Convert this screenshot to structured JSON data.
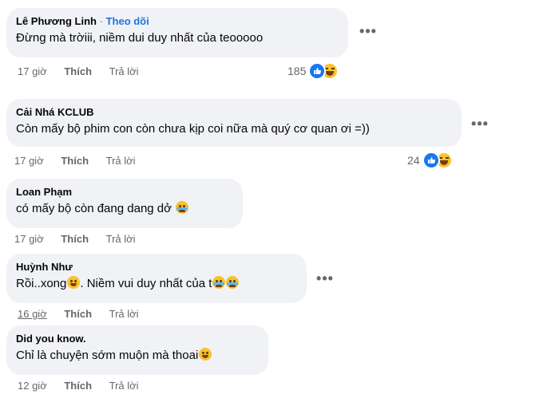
{
  "comments": [
    {
      "author": "Lê Phương Linh",
      "follow_separator": "·",
      "follow_label": "Theo dõi",
      "text": "Đừng mà trờiii, niềm dui duy nhất của teooooo",
      "time": "17 giờ",
      "like_label": "Thích",
      "reply_label": "Trả lời",
      "reaction_count": "185",
      "reactions": [
        "like-icon",
        "haha-icon"
      ]
    },
    {
      "author": "Cải Nhá KCLUB",
      "text": "Còn mấy bộ phim con còn chưa kịp coi nữa mà quý cơ quan ơi =))",
      "time": "17 giờ",
      "like_label": "Thích",
      "reply_label": "Trả lời",
      "reaction_count": "24",
      "reactions": [
        "like-icon",
        "haha-icon"
      ]
    },
    {
      "author": "Loan Phạm",
      "text": "có mấy bộ còn đang dang dở",
      "emoji": [
        "crying-face-icon"
      ],
      "time": "17 giờ",
      "like_label": "Thích",
      "reply_label": "Trả lời"
    },
    {
      "author": "Huỳnh Như",
      "text_parts": [
        "Rồi..xong",
        ". Niềm vui duy nhất của t"
      ],
      "emoji": [
        "sleepy-face-icon",
        "crying-face-icon",
        "crying-face-icon"
      ],
      "time": "16 giờ",
      "like_label": "Thích",
      "reply_label": "Trả lời"
    },
    {
      "author": "Did you know.",
      "text": "Chỉ là chuyện sớm muộn mà thoai",
      "emoji": [
        "rolling-laughing-icon"
      ],
      "time": "12 giờ",
      "like_label": "Thích",
      "reply_label": "Trả lời"
    }
  ],
  "more_options_label": "•••"
}
